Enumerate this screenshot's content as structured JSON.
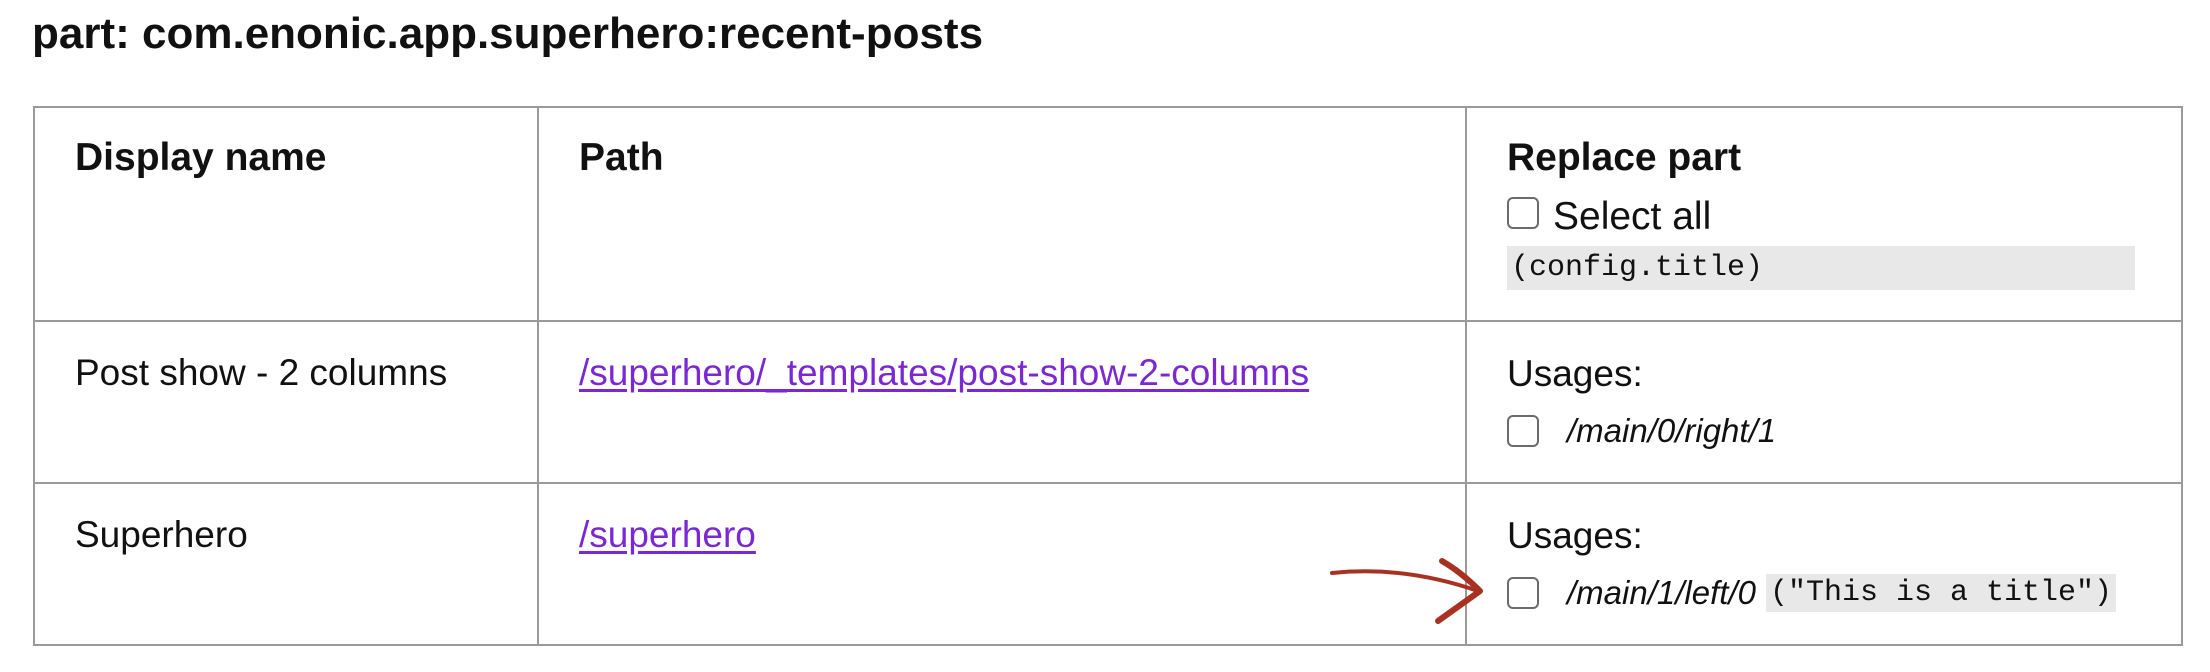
{
  "title": "part: com.enonic.app.superhero:recent-posts",
  "table": {
    "headers": {
      "display_name": "Display name",
      "path": "Path",
      "replace_part": "Replace part"
    },
    "select_all_label": "Select all",
    "config_key": "(config.title)",
    "rows": [
      {
        "display_name": "Post show - 2 columns",
        "path": "/superhero/_templates/post-show-2-columns",
        "usages_label": "Usages:",
        "usages": [
          {
            "path": "/main/0/right/1",
            "config_value": ""
          }
        ]
      },
      {
        "display_name": "Superhero",
        "path": "/superhero",
        "usages_label": "Usages:",
        "usages": [
          {
            "path": "/main/1/left/0",
            "config_value": "(\"This is a title\")"
          }
        ]
      }
    ]
  },
  "colors": {
    "link": "#7a28d4",
    "annotation_arrow": "#a83222",
    "code_background": "#e8e8e8",
    "table_border": "#9a9a9a"
  },
  "icons": {
    "annotation": "hand-drawn-arrow-icon",
    "checkbox": "checkbox-unchecked"
  }
}
